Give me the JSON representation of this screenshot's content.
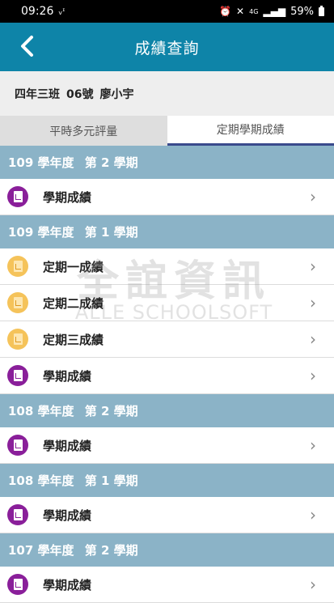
{
  "status_bar": {
    "time": "09:26",
    "left_icons": [
      "signal-strength-icon"
    ],
    "right_icons": [
      "alarm-icon",
      "mute-icon",
      "4g-icon",
      "signal-bars-icon"
    ],
    "battery": "59%"
  },
  "header": {
    "title": "成績查詢",
    "back_icon": "chevron-left-icon"
  },
  "student": {
    "class": "四年三班",
    "seat": "06號",
    "name": "廖小宇"
  },
  "tabs": [
    {
      "label": "平時多元評量",
      "active": false
    },
    {
      "label": "定期學期成績",
      "active": true
    }
  ],
  "sections": [
    {
      "year": "109 學年度",
      "semester": "第 2 學期",
      "items": [
        {
          "label": "學期成績",
          "icon": "purple"
        }
      ]
    },
    {
      "year": "109 學年度",
      "semester": "第 1 學期",
      "items": [
        {
          "label": "定期一成績",
          "icon": "yellow"
        },
        {
          "label": "定期二成績",
          "icon": "yellow"
        },
        {
          "label": "定期三成績",
          "icon": "yellow"
        },
        {
          "label": "學期成績",
          "icon": "purple"
        }
      ]
    },
    {
      "year": "108 學年度",
      "semester": "第 2 學期",
      "items": [
        {
          "label": "學期成績",
          "icon": "purple"
        }
      ]
    },
    {
      "year": "108 學年度",
      "semester": "第 1 學期",
      "items": [
        {
          "label": "學期成績",
          "icon": "purple"
        }
      ]
    },
    {
      "year": "107 學年度",
      "semester": "第 2 學期",
      "items": [
        {
          "label": "學期成績",
          "icon": "purple"
        }
      ]
    }
  ],
  "watermark": {
    "cn": "全誼資訊",
    "en": "ALLE SCHOOLSOFT"
  },
  "colors": {
    "header": "#0e84a8",
    "section": "#8bb3c7",
    "purple_icon": "#8a1f9a",
    "yellow_icon": "#f5c35a",
    "tab_underline": "#3a4a8c"
  }
}
